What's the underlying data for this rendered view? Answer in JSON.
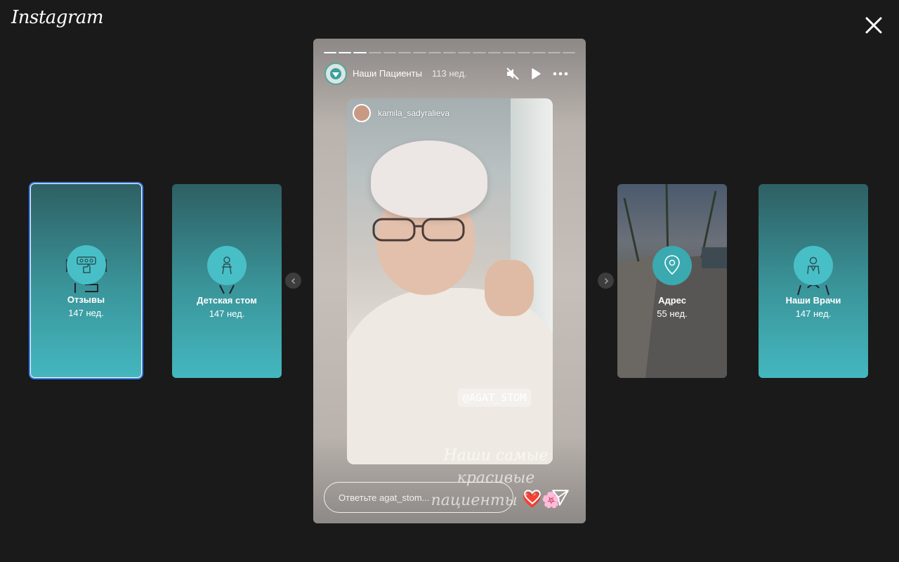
{
  "app": {
    "logo": "Instagram"
  },
  "highlights": [
    {
      "title": "Отзывы",
      "age": "147 нед.",
      "selected": true
    },
    {
      "title": "Детская стом",
      "age": "147 нед."
    },
    {
      "title": "Адрес",
      "age": "55 нед."
    },
    {
      "title": "Наши Врачи",
      "age": "147 нед."
    }
  ],
  "story": {
    "account": "Наши Пациенты",
    "time": "113 нед.",
    "progress": {
      "segments": 17,
      "completed": 3
    },
    "inner_username": "kamila_sadyralieva",
    "tag": "@AGAT_STOM",
    "caption_line1": "Наши самые красивые",
    "caption_line2": "пациенты",
    "caption_emoji": "❤️🌸",
    "reply_placeholder": "Ответьте agat_stom..."
  },
  "icons": {
    "close": "close-icon",
    "mute": "muted-speaker-icon",
    "play": "play-icon",
    "more": "more-icon",
    "prev": "chevron-left-icon",
    "next": "chevron-right-icon",
    "like": "heart-icon",
    "share": "send-icon"
  },
  "colors": {
    "background": "#1a1a1a",
    "teal": "#44b7bf",
    "selected_outline": "#3f7ee8"
  }
}
